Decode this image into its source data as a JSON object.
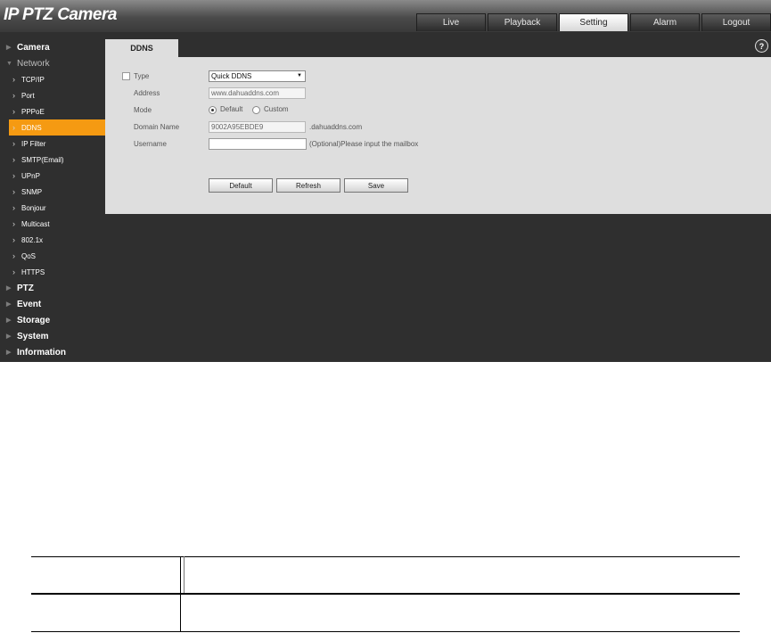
{
  "app": {
    "title": "IP PTZ Camera"
  },
  "top_tabs": [
    "Live",
    "Playback",
    "Setting",
    "Alarm",
    "Logout"
  ],
  "active_top_tab": "Setting",
  "sidebar": {
    "camera": "Camera",
    "network": "Network",
    "network_items": [
      "TCP/IP",
      "Port",
      "PPPoE",
      "DDNS",
      "IP Filter",
      "SMTP(Email)",
      "UPnP",
      "SNMP",
      "Bonjour",
      "Multicast",
      "802.1x",
      "QoS",
      "HTTPS"
    ],
    "active_item": "DDNS",
    "bottom": [
      "PTZ",
      "Event",
      "Storage",
      "System",
      "Information"
    ]
  },
  "content": {
    "tab": "DDNS",
    "type_label": "Type",
    "type_value": "Quick DDNS",
    "address_label": "Address",
    "address_value": "www.dahuaddns.com",
    "mode_label": "Mode",
    "mode_default": "Default",
    "mode_custom": "Custom",
    "domain_label": "Domain Name",
    "domain_value": "9002A95EBDE9",
    "domain_suffix": ".dahuaddns.com",
    "username_label": "Username",
    "username_value": "",
    "username_hint": "(Optional)Please input the mailbox",
    "buttons": [
      "Default",
      "Refresh",
      "Save"
    ]
  }
}
